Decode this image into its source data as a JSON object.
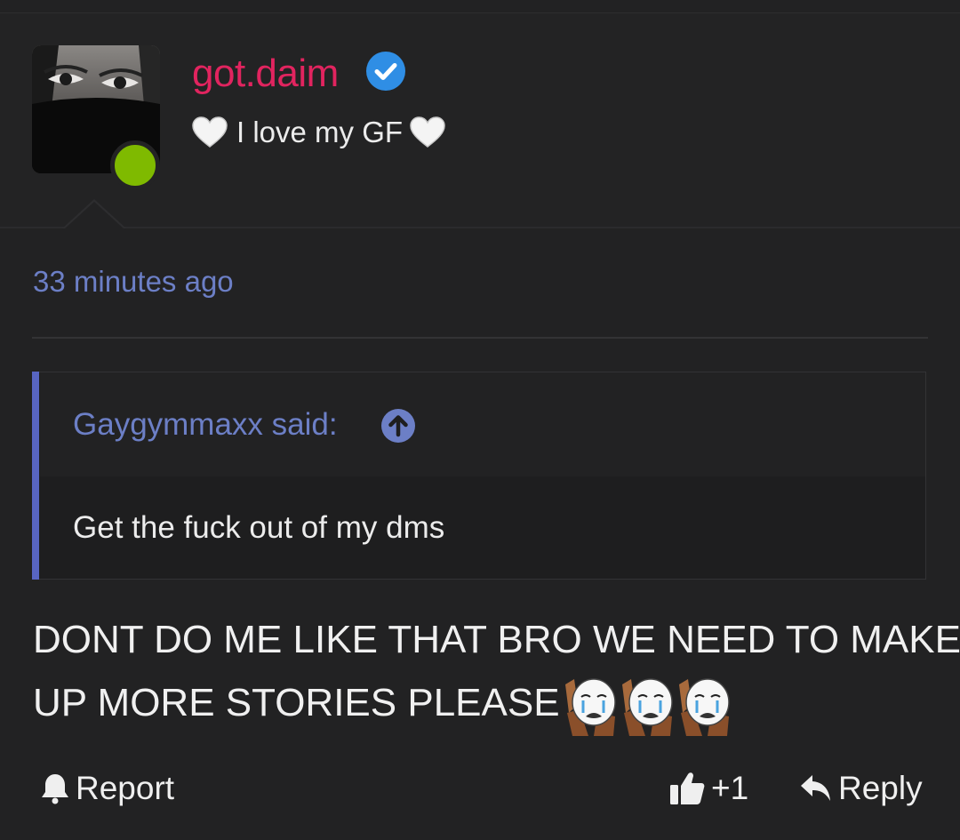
{
  "post": {
    "author": {
      "username": "got.daim",
      "verified": true,
      "custom_title": "I love my GF",
      "title_icon": "white-heart-icon",
      "online": true,
      "online_color": "#7fba00",
      "username_color": "#e1245f"
    },
    "timestamp": "33 minutes ago",
    "quote": {
      "author_label": "Gaygymmaxx said:",
      "arrow_icon": "arrow-up-circle-icon",
      "text": "Get the fuck out of my dms"
    },
    "message": {
      "line1": "DONT DO ME LIKE THAT BRO WE NEED TO MAKE",
      "line2": "UP MORE STORIES PLEASE",
      "emoji": [
        "crying-meme-face-icon",
        "crying-meme-face-icon",
        "crying-meme-face-icon"
      ]
    },
    "actions": {
      "report_label": "Report",
      "like_count": "+1",
      "reply_label": "Reply"
    }
  },
  "colors": {
    "background": "#222223",
    "link": "#6c7fc6",
    "quote_bar": "#5865c2",
    "verified_badge": "#2f8ee5"
  }
}
